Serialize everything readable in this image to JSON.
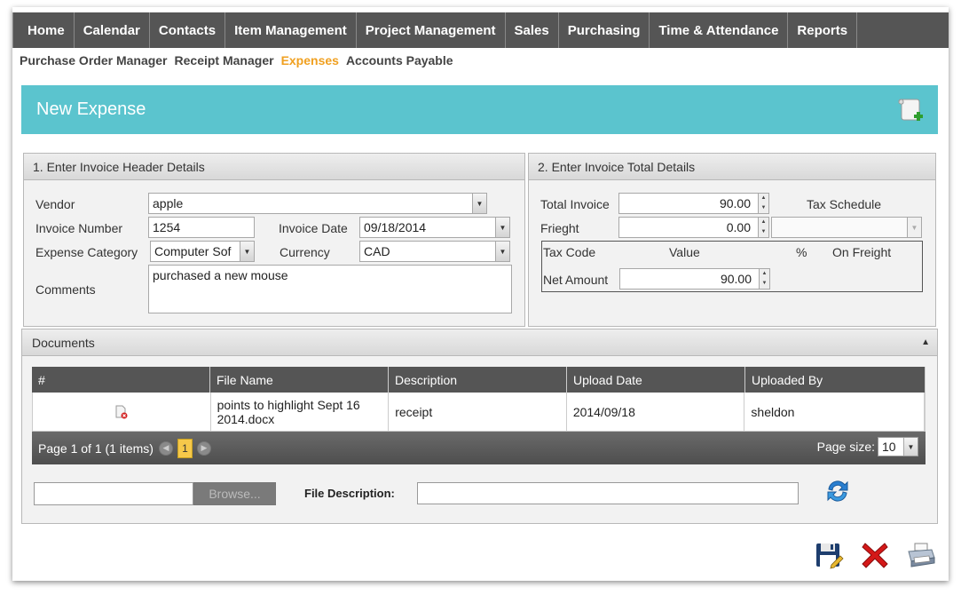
{
  "nav": {
    "items": [
      "Home",
      "Calendar",
      "Contacts",
      "Item Management",
      "Project Management",
      "Sales",
      "Purchasing",
      "Time & Attendance",
      "Reports"
    ]
  },
  "subnav": {
    "items": [
      "Purchase Order Manager",
      "Receipt Manager",
      "Expenses",
      "Accounts Payable"
    ],
    "active": "Expenses",
    "active_color": "#f0a020"
  },
  "banner": {
    "title": "New Expense",
    "color": "#5bc4ce",
    "icon": "add-document-icon"
  },
  "header_panel": {
    "title": "1. Enter Invoice Header Details",
    "vendor_label": "Vendor",
    "vendor_value": "apple",
    "invoice_number_label": "Invoice Number",
    "invoice_number_value": "1254",
    "invoice_date_label": "Invoice Date",
    "invoice_date_value": "09/18/2014",
    "expense_category_label": "Expense Category",
    "expense_category_value": "Computer Sof",
    "currency_label": "Currency",
    "currency_value": "CAD",
    "comments_label": "Comments",
    "comments_value": "purchased a new mouse"
  },
  "total_panel": {
    "title": "2. Enter Invoice Total Details",
    "total_invoice_label": "Total Invoice",
    "total_invoice_value": "90.00",
    "tax_schedule_label": "Tax Schedule",
    "freight_label": "Frieght",
    "freight_value": "0.00",
    "tax_code_label": "Tax Code",
    "value_label": "Value",
    "percent_label": "%",
    "on_freight_label": "On Freight",
    "net_amount_label": "Net Amount",
    "net_amount_value": "90.00"
  },
  "documents": {
    "title": "Documents",
    "columns": [
      "#",
      "File Name",
      "Description",
      "Upload Date",
      "Uploaded By"
    ],
    "rows": [
      {
        "file_name": "points to highlight Sept 16 2014.docx",
        "description": "receipt",
        "upload_date": "2014/09/18",
        "uploaded_by": "sheldon"
      }
    ],
    "pager_text": "Page 1 of 1 (1 items)",
    "current_page": "1",
    "page_size_label": "Page size:",
    "page_size_value": "10",
    "browse_label": "Browse...",
    "file_description_label": "File Description:"
  },
  "actions": [
    "save-icon",
    "cancel-icon",
    "print-icon"
  ]
}
